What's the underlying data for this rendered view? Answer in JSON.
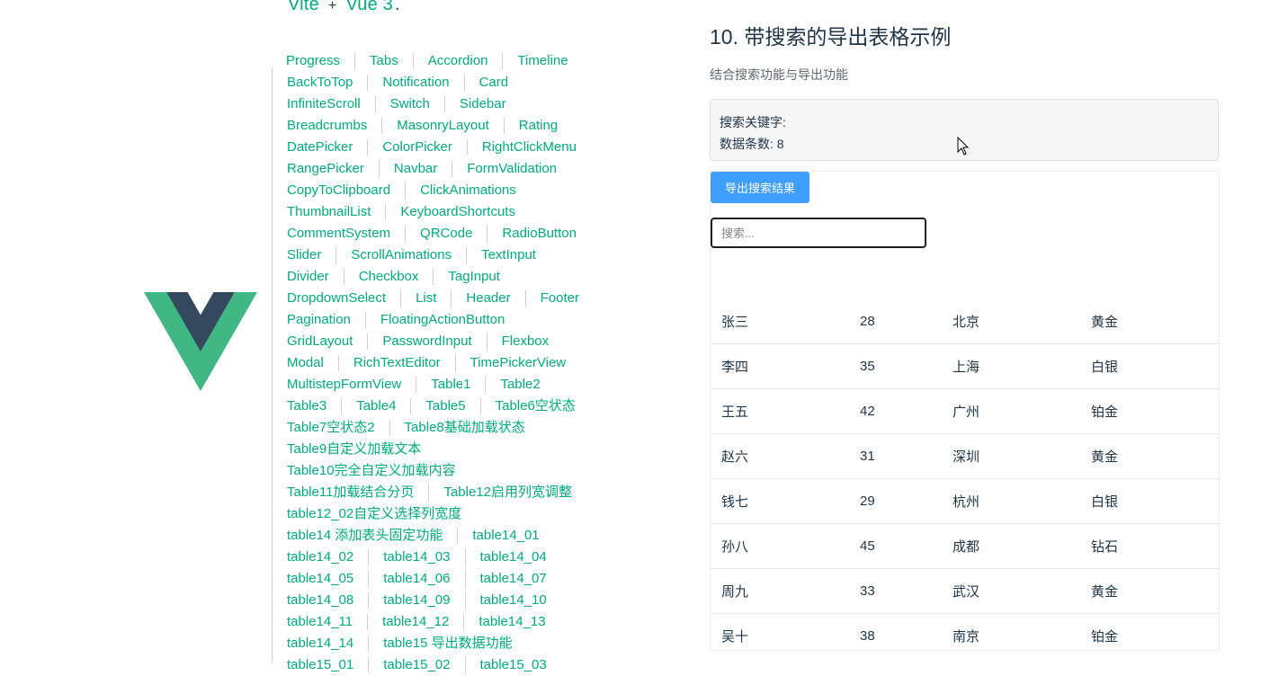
{
  "header": {
    "part1": "Vite",
    "plus": "+",
    "part2": "Vue 3",
    "period": "."
  },
  "nav": {
    "rows": [
      [
        "Progress",
        "Tabs",
        "Accordion",
        "Timeline"
      ],
      [
        "BackToTop",
        "Notification",
        "Card"
      ],
      [
        "InfiniteScroll",
        "Switch",
        "Sidebar"
      ],
      [
        "Breadcrumbs",
        "MasonryLayout",
        "Rating"
      ],
      [
        "DatePicker",
        "ColorPicker",
        "RightClickMenu"
      ],
      [
        "RangePicker",
        "Navbar",
        "FormValidation"
      ],
      [
        "CopyToClipboard",
        "ClickAnimations"
      ],
      [
        "ThumbnailList",
        "KeyboardShortcuts"
      ],
      [
        "CommentSystem",
        "QRCode",
        "RadioButton"
      ],
      [
        "Slider",
        "ScrollAnimations",
        "TextInput"
      ],
      [
        "Divider",
        "Checkbox",
        "TagInput"
      ],
      [
        "DropdownSelect",
        "List",
        "Header",
        "Footer"
      ],
      [
        "Pagination",
        "FloatingActionButton"
      ],
      [
        "GridLayout",
        "PasswordInput",
        "Flexbox"
      ],
      [
        "Modal",
        "RichTextEditor",
        "TimePickerView"
      ],
      [
        "MultistepFormView",
        "Table1",
        "Table2"
      ],
      [
        "Table3",
        "Table4",
        "Table5",
        "Table6空状态"
      ],
      [
        "Table7空状态2",
        "Table8基础加载状态"
      ],
      [
        "Table9自定义加载文本"
      ],
      [
        "Table10完全自定义加载内容"
      ],
      [
        "Table11加载结合分页",
        "Table12启用列宽调整"
      ],
      [
        "table12_02自定义选择列宽度"
      ],
      [
        "table14 添加表头固定功能",
        "table14_01"
      ],
      [
        "table14_02",
        "table14_03",
        "table14_04"
      ],
      [
        "table14_05",
        "table14_06",
        "table14_07"
      ],
      [
        "table14_08",
        "table14_09",
        "table14_10"
      ],
      [
        "table14_11",
        "table14_12",
        "table14_13"
      ],
      [
        "table14_14",
        "table15 导出数据功能"
      ],
      [
        "table15_01",
        "table15_02",
        "table15_03"
      ]
    ]
  },
  "section": {
    "title": "10. 带搜索的导出表格示例",
    "description": "结合搜索功能与导出功能",
    "keyword_label": "搜索关键字:",
    "count_label": "数据条数: 8",
    "export_label": "导出搜索结果",
    "search_placeholder": "搜索..."
  },
  "table": {
    "rows": [
      [
        "张三",
        "28",
        "北京",
        "黄金"
      ],
      [
        "李四",
        "35",
        "上海",
        "白银"
      ],
      [
        "王五",
        "42",
        "广州",
        "铂金"
      ],
      [
        "赵六",
        "31",
        "深圳",
        "黄金"
      ],
      [
        "钱七",
        "29",
        "杭州",
        "白银"
      ],
      [
        "孙八",
        "45",
        "成都",
        "钻石"
      ],
      [
        "周九",
        "33",
        "武汉",
        "黄金"
      ],
      [
        "吴十",
        "38",
        "南京",
        "铂金"
      ]
    ]
  },
  "colors": {
    "accent": "#00a97f",
    "button": "#409eff",
    "text": "#213547"
  }
}
